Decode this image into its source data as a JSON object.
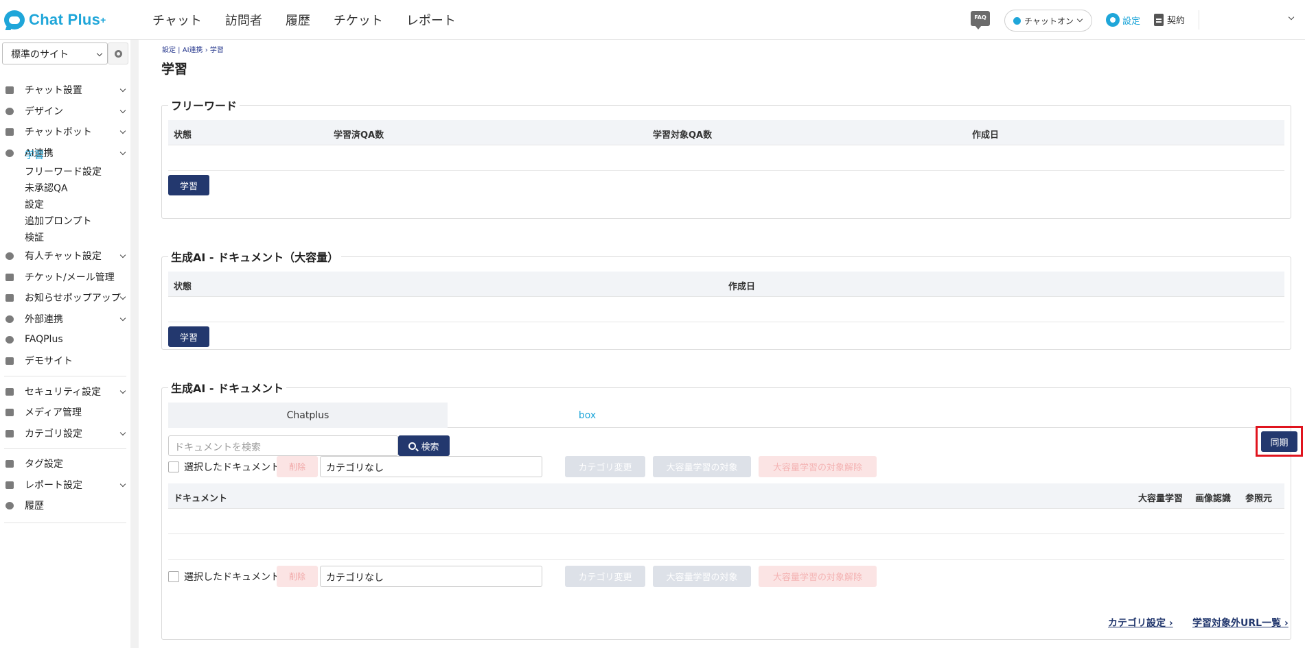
{
  "app": {
    "logo_text": "Chat Plus"
  },
  "header": {
    "nav": [
      "チャット",
      "訪問者",
      "履歴",
      "チケット",
      "レポート"
    ],
    "faq_badge": "FAQ",
    "status": "チャットオン",
    "settings": "設定",
    "contract": "契約"
  },
  "sidebar": {
    "site_select": "標準のサイト",
    "items": {
      "chat_settings": "チャット設置",
      "design": "デザイン",
      "chatbot": "チャットボット",
      "ai": "AI連携",
      "manned": "有人チャット設定",
      "ticket": "チケット/メール管理",
      "popup": "お知らせポップアップ",
      "external": "外部連携",
      "faqplus": "FAQPlus",
      "demo": "デモサイト",
      "security": "セキュリティ設定",
      "media": "メディア管理",
      "category": "カテゴリ設定",
      "tag": "タグ設定",
      "report": "レポート設定",
      "history": "履歴"
    },
    "ai_sub": [
      "学習",
      "フリーワード設定",
      "未承認QA",
      "設定",
      "追加プロンプト",
      "検証"
    ]
  },
  "main": {
    "breadcrumb": "設定 | AI連携 › 学習",
    "title": "学習",
    "freeword": {
      "title": "フリーワード",
      "cols": [
        "状態",
        "学習済QA数",
        "学習対象QA数",
        "作成日"
      ],
      "learn_btn": "学習"
    },
    "genai_large": {
      "title": "生成AI - ドキュメント（大容量）",
      "cols": [
        "状態",
        "作成日"
      ],
      "learn_btn": "学習"
    },
    "genai_doc": {
      "title": "生成AI - ドキュメント",
      "tabs": [
        "Chatplus",
        "box"
      ],
      "search_placeholder": "ドキュメントを検索",
      "search_btn": "検索",
      "sync_btn": "同期",
      "selected_label": "選択したドキュメントを",
      "delete_btn": "削除",
      "category_value": "カテゴリなし",
      "change_cat_btn": "カテゴリ変更",
      "large_target_btn": "大容量学習の対象",
      "large_untarget_btn": "大容量学習の対象解除",
      "cols": [
        "ドキュメント",
        "大容量学習",
        "画像認識",
        "参照元"
      ]
    },
    "footer_links": [
      "カテゴリ設定",
      "学習対象外URL一覧"
    ]
  }
}
